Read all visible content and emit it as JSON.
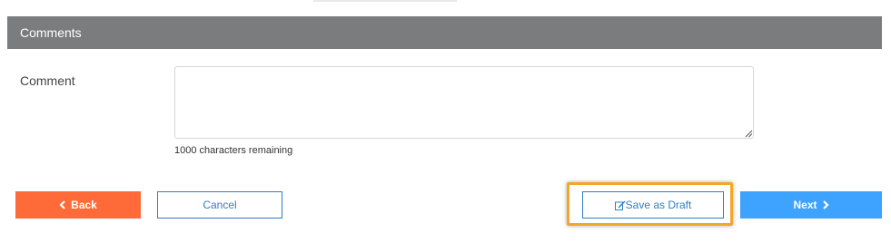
{
  "section": {
    "title": "Comments"
  },
  "comment": {
    "label": "Comment",
    "value": "",
    "chars_remaining": "1000 characters remaining"
  },
  "actions": {
    "back_label": "Back",
    "cancel_label": "Cancel",
    "draft_label": "Save as Draft",
    "next_label": "Next"
  },
  "icons": {
    "back": "chevron-left-icon",
    "draft": "edit-icon",
    "next": "chevron-right-icon",
    "resize": "resize-grip-icon"
  },
  "colors": {
    "header_bg": "#7a7c7e",
    "back_bg": "#ff6a39",
    "next_bg": "#3ea2ff",
    "link_blue": "#2e7fc4",
    "highlight": "#f1a829"
  }
}
